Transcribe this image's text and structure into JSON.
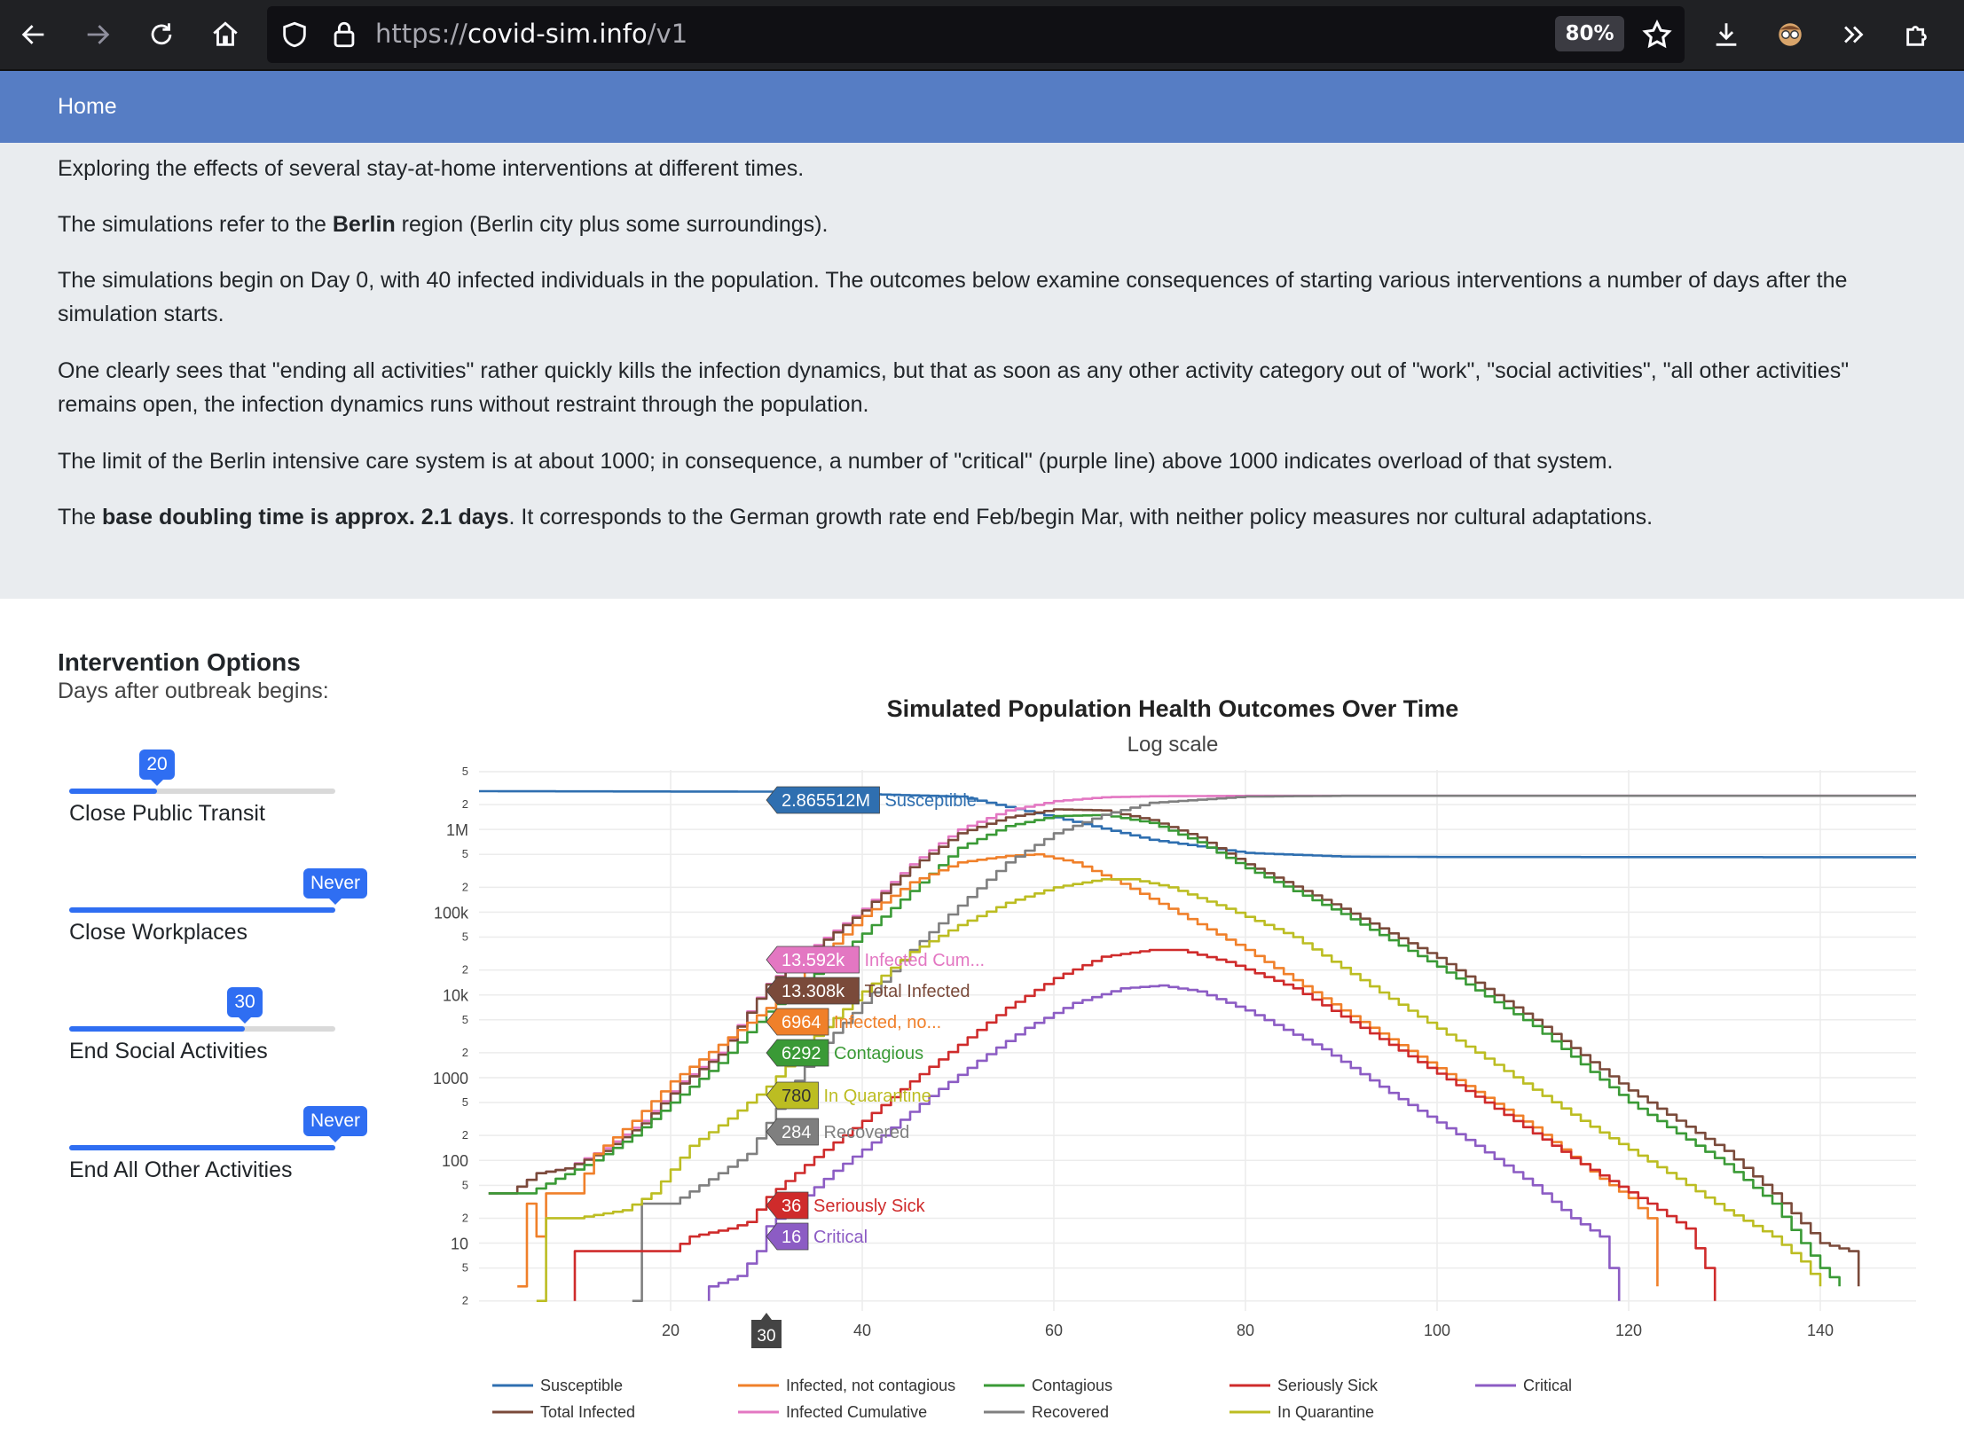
{
  "browser": {
    "url_scheme": "https://",
    "url_host": "covid-sim.info",
    "url_path": "/v1",
    "zoom": "80%"
  },
  "nav": {
    "home": "Home"
  },
  "intro": {
    "p1": "Exploring the effects of several stay-at-home interventions at different times.",
    "p2_a": "The simulations refer to the ",
    "p2_b": "Berlin",
    "p2_c": " region (Berlin city plus some surroundings).",
    "p3": "The simulations begin on Day 0, with 40 infected individuals in the population. The outcomes below examine consequences of starting various interventions a number of days after the simulation starts.",
    "p4": "One clearly sees that \"ending all activities\" rather quickly kills the infection dynamics, but that as soon as any other activity category out of \"work\", \"social activities\", \"all other activities\" remains open, the infection dynamics runs without restraint through the population.",
    "p5": "The limit of the Berlin intensive care system is at about 1000; in consequence, a number of \"critical\" (purple line) above 1000 indicates overload of that system.",
    "p6_a": "The ",
    "p6_b": "base doubling time is approx. 2.1 days",
    "p6_c": ". It corresponds to the German growth rate end Feb/begin Mar, with neither policy measures nor cultural adaptations."
  },
  "options": {
    "title": "Intervention Options",
    "subtitle": "Days after outbreak begins:",
    "sliders": [
      {
        "label": "Close Public Transit",
        "value": "20",
        "fraction": 0.33
      },
      {
        "label": "Close Workplaces",
        "value": "Never",
        "fraction": 1.0
      },
      {
        "label": "End Social Activities",
        "value": "30",
        "fraction": 0.66
      },
      {
        "label": "End All Other Activities",
        "value": "Never",
        "fraction": 1.0
      }
    ]
  },
  "colors": {
    "susceptible": "#2f6fb0",
    "total_infected": "#7a4a3a",
    "infected_nc": "#f0802a",
    "infected_cum": "#e377c2",
    "contagious": "#3a9a36",
    "recovered": "#7f7f7f",
    "seriously_sick": "#cf2b2b",
    "in_quarantine": "#bcbd22",
    "critical": "#8c5cc4"
  },
  "chart_data": {
    "type": "line",
    "title": "Simulated Population Health Outcomes Over Time",
    "subtitle": "Log scale",
    "x_ticks": [
      "20",
      "40",
      "60",
      "80",
      "100",
      "120",
      "140"
    ],
    "y_ticks": [
      {
        "v": 2,
        "t": "2"
      },
      {
        "v": 5,
        "t": "5"
      },
      {
        "v": 10,
        "t": "10"
      },
      {
        "v": 20,
        "t": "2"
      },
      {
        "v": 50,
        "t": "5"
      },
      {
        "v": 100,
        "t": "100"
      },
      {
        "v": 200,
        "t": "2"
      },
      {
        "v": 500,
        "t": "5"
      },
      {
        "v": 1000,
        "t": "1000"
      },
      {
        "v": 2000,
        "t": "2"
      },
      {
        "v": 5000,
        "t": "5"
      },
      {
        "v": 10000,
        "t": "10k"
      },
      {
        "v": 20000,
        "t": "2"
      },
      {
        "v": 50000,
        "t": "5"
      },
      {
        "v": 100000,
        "t": "100k"
      },
      {
        "v": 200000,
        "t": "2"
      },
      {
        "v": 500000,
        "t": "5"
      },
      {
        "v": 1000000,
        "t": "1M"
      },
      {
        "v": 2000000,
        "t": "2"
      },
      {
        "v": 5000000,
        "t": "5"
      }
    ],
    "xlim": [
      0,
      150
    ],
    "ylim_log10": [
      0.18,
      6.72
    ],
    "y_scale": "log",
    "hover_day": "30",
    "hover_labels": [
      {
        "key": "susceptible",
        "value": "2.865512M",
        "name": "Susceptible",
        "y": 2865512
      },
      {
        "key": "infected_cum",
        "value": "13.592k",
        "name": "Infected Cum...",
        "y": 13592
      },
      {
        "key": "total_infected",
        "value": "13.308k",
        "name": "Total Infected",
        "y": 13308
      },
      {
        "key": "infected_nc",
        "value": "6964",
        "name": "Infected, no...",
        "y": 6964
      },
      {
        "key": "contagious",
        "value": "6292",
        "name": "Contagious",
        "y": 6292
      },
      {
        "key": "in_quarantine",
        "value": "780",
        "name": "In Quarantine",
        "y": 780
      },
      {
        "key": "recovered",
        "value": "284",
        "name": "Recovered",
        "y": 284
      },
      {
        "key": "seriously_sick",
        "value": "36",
        "name": "Seriously Sick",
        "y": 36
      },
      {
        "key": "critical",
        "value": "16",
        "name": "Critical",
        "y": 16
      }
    ],
    "legend": [
      {
        "key": "susceptible",
        "name": "Susceptible"
      },
      {
        "key": "infected_nc",
        "name": "Infected, not contagious"
      },
      {
        "key": "contagious",
        "name": "Contagious"
      },
      {
        "key": "seriously_sick",
        "name": "Seriously Sick"
      },
      {
        "key": "critical",
        "name": "Critical"
      },
      {
        "key": "total_infected",
        "name": "Total Infected"
      },
      {
        "key": "infected_cum",
        "name": "Infected Cumulative"
      },
      {
        "key": "recovered",
        "name": "Recovered"
      },
      {
        "key": "in_quarantine",
        "name": "In Quarantine"
      }
    ],
    "series": [
      {
        "key": "susceptible",
        "name": "Susceptible",
        "points": [
          [
            0,
            2900000
          ],
          [
            30,
            2865512
          ],
          [
            50,
            2500000
          ],
          [
            60,
            1400000
          ],
          [
            70,
            750000
          ],
          [
            80,
            520000
          ],
          [
            90,
            470000
          ],
          [
            100,
            465000
          ],
          [
            150,
            462000
          ]
        ]
      },
      {
        "key": "infected_cum",
        "name": "Infected Cumulative",
        "points": [
          [
            1,
            40
          ],
          [
            3,
            40
          ],
          [
            6,
            70
          ],
          [
            9,
            80
          ],
          [
            13,
            140
          ],
          [
            17,
            300
          ],
          [
            21,
            900
          ],
          [
            25,
            2000
          ],
          [
            30,
            13592
          ],
          [
            35,
            40000
          ],
          [
            40,
            110000
          ],
          [
            45,
            380000
          ],
          [
            50,
            1000000
          ],
          [
            55,
            1700000
          ],
          [
            60,
            2200000
          ],
          [
            65,
            2450000
          ],
          [
            70,
            2520000
          ],
          [
            80,
            2550000
          ],
          [
            150,
            2550000
          ]
        ]
      },
      {
        "key": "total_infected",
        "name": "Total Infected",
        "points": [
          [
            1,
            40
          ],
          [
            3,
            40
          ],
          [
            6,
            70
          ],
          [
            9,
            80
          ],
          [
            13,
            130
          ],
          [
            17,
            280
          ],
          [
            21,
            850
          ],
          [
            25,
            1900
          ],
          [
            30,
            13308
          ],
          [
            35,
            38000
          ],
          [
            40,
            105000
          ],
          [
            45,
            350000
          ],
          [
            50,
            900000
          ],
          [
            55,
            1400000
          ],
          [
            60,
            1750000
          ],
          [
            65,
            1700000
          ],
          [
            70,
            1300000
          ],
          [
            75,
            800000
          ],
          [
            80,
            380000
          ],
          [
            90,
            110000
          ],
          [
            100,
            28000
          ],
          [
            110,
            5000
          ],
          [
            120,
            700
          ],
          [
            130,
            130
          ],
          [
            135,
            40
          ],
          [
            140,
            10
          ],
          [
            143,
            8
          ],
          [
            144,
            3
          ]
        ]
      },
      {
        "key": "contagious",
        "name": "Contagious",
        "points": [
          [
            1,
            40
          ],
          [
            5,
            40
          ],
          [
            8,
            60
          ],
          [
            12,
            100
          ],
          [
            16,
            200
          ],
          [
            20,
            500
          ],
          [
            25,
            1500
          ],
          [
            30,
            6292
          ],
          [
            35,
            18000
          ],
          [
            40,
            55000
          ],
          [
            45,
            180000
          ],
          [
            50,
            600000
          ],
          [
            55,
            1100000
          ],
          [
            60,
            1450000
          ],
          [
            65,
            1500000
          ],
          [
            70,
            1200000
          ],
          [
            75,
            700000
          ],
          [
            80,
            340000
          ],
          [
            90,
            95000
          ],
          [
            100,
            22000
          ],
          [
            110,
            4200
          ],
          [
            120,
            500
          ],
          [
            130,
            90
          ],
          [
            135,
            30
          ],
          [
            138,
            10
          ],
          [
            140,
            5
          ],
          [
            142,
            3
          ]
        ]
      },
      {
        "key": "infected_nc",
        "name": "Infected, not contagious",
        "points": [
          [
            4,
            3
          ],
          [
            5,
            30
          ],
          [
            6,
            12
          ],
          [
            7,
            40
          ],
          [
            10,
            40
          ],
          [
            12,
            120
          ],
          [
            16,
            300
          ],
          [
            20,
            900
          ],
          [
            25,
            2500
          ],
          [
            30,
            6964
          ],
          [
            35,
            25000
          ],
          [
            40,
            90000
          ],
          [
            45,
            230000
          ],
          [
            50,
            400000
          ],
          [
            55,
            480000
          ],
          [
            58,
            500000
          ],
          [
            62,
            400000
          ],
          [
            67,
            220000
          ],
          [
            72,
            110000
          ],
          [
            80,
            35000
          ],
          [
            90,
            6500
          ],
          [
            100,
            1300
          ],
          [
            110,
            250
          ],
          [
            117,
            60
          ],
          [
            120,
            35
          ],
          [
            122,
            20
          ],
          [
            123,
            3
          ]
        ]
      },
      {
        "key": "recovered",
        "name": "Recovered",
        "points": [
          [
            16,
            2
          ],
          [
            17,
            30
          ],
          [
            20,
            30
          ],
          [
            25,
            70
          ],
          [
            28,
            120
          ],
          [
            30,
            284
          ],
          [
            35,
            2000
          ],
          [
            40,
            8000
          ],
          [
            45,
            35000
          ],
          [
            50,
            120000
          ],
          [
            55,
            400000
          ],
          [
            60,
            900000
          ],
          [
            65,
            1500000
          ],
          [
            70,
            2100000
          ],
          [
            80,
            2500000
          ],
          [
            90,
            2550000
          ],
          [
            150,
            2550000
          ]
        ]
      },
      {
        "key": "in_quarantine",
        "name": "In Quarantine",
        "points": [
          [
            6,
            2
          ],
          [
            7,
            20
          ],
          [
            10,
            20
          ],
          [
            15,
            25
          ],
          [
            18,
            40
          ],
          [
            22,
            150
          ],
          [
            26,
            320
          ],
          [
            30,
            780
          ],
          [
            35,
            3200
          ],
          [
            40,
            11000
          ],
          [
            45,
            33000
          ],
          [
            50,
            70000
          ],
          [
            55,
            130000
          ],
          [
            60,
            200000
          ],
          [
            65,
            250000
          ],
          [
            68,
            250000
          ],
          [
            72,
            200000
          ],
          [
            78,
            110000
          ],
          [
            85,
            50000
          ],
          [
            95,
            9000
          ],
          [
            105,
            1700
          ],
          [
            115,
            300
          ],
          [
            125,
            60
          ],
          [
            130,
            25
          ],
          [
            135,
            12
          ],
          [
            138,
            6
          ],
          [
            140,
            3
          ]
        ]
      },
      {
        "key": "seriously_sick",
        "name": "Seriously Sick",
        "points": [
          [
            10,
            2
          ],
          [
            10,
            8
          ],
          [
            16,
            8
          ],
          [
            20,
            8
          ],
          [
            22,
            12
          ],
          [
            26,
            15
          ],
          [
            28,
            18
          ],
          [
            30,
            36
          ],
          [
            35,
            110
          ],
          [
            40,
            300
          ],
          [
            45,
            900
          ],
          [
            50,
            2500
          ],
          [
            55,
            7000
          ],
          [
            60,
            16000
          ],
          [
            65,
            29000
          ],
          [
            70,
            35000
          ],
          [
            73,
            35000
          ],
          [
            78,
            25000
          ],
          [
            85,
            12000
          ],
          [
            95,
            2500
          ],
          [
            105,
            500
          ],
          [
            115,
            90
          ],
          [
            122,
            30
          ],
          [
            126,
            15
          ],
          [
            128,
            5
          ],
          [
            129,
            2
          ]
        ]
      },
      {
        "key": "critical",
        "name": "Critical",
        "points": [
          [
            24,
            2
          ],
          [
            24,
            3
          ],
          [
            27,
            4
          ],
          [
            29,
            8
          ],
          [
            30,
            16
          ],
          [
            33,
            30
          ],
          [
            37,
            75
          ],
          [
            42,
            200
          ],
          [
            47,
            600
          ],
          [
            52,
            1600
          ],
          [
            57,
            4000
          ],
          [
            62,
            8000
          ],
          [
            67,
            12000
          ],
          [
            71,
            13000
          ],
          [
            75,
            11000
          ],
          [
            80,
            6500
          ],
          [
            88,
            2200
          ],
          [
            96,
            550
          ],
          [
            104,
            150
          ],
          [
            110,
            50
          ],
          [
            114,
            20
          ],
          [
            117,
            12
          ],
          [
            118,
            5
          ],
          [
            119,
            2
          ]
        ]
      }
    ]
  }
}
